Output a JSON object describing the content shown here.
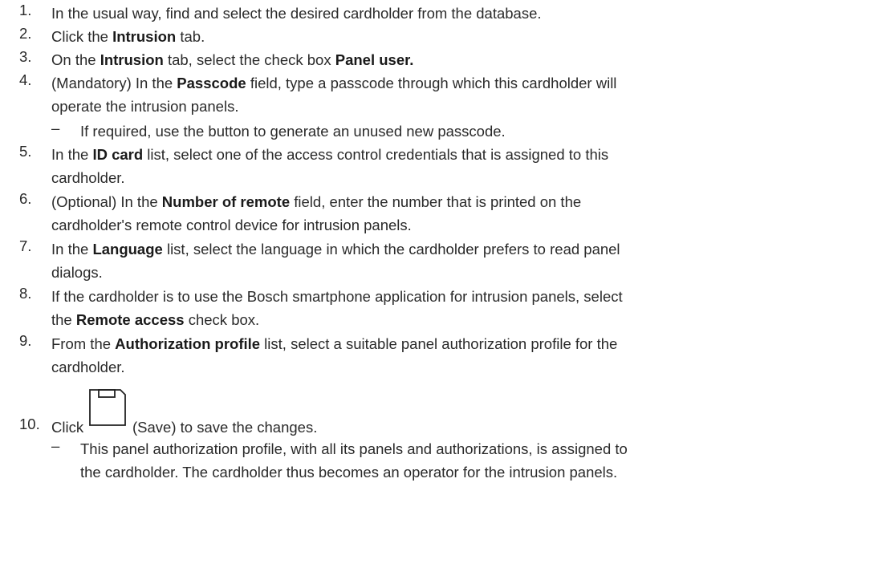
{
  "steps": [
    {
      "num": "1.",
      "parts": [
        {
          "t": "In the usual way, find and select the desired cardholder from the database."
        }
      ]
    },
    {
      "num": "2.",
      "parts": [
        {
          "t": "Click the "
        },
        {
          "b": "Intrusion"
        },
        {
          "t": " tab."
        }
      ]
    },
    {
      "num": "3.",
      "parts": [
        {
          "t": "On the "
        },
        {
          "b": "Intrusion"
        },
        {
          "t": " tab, select the check box "
        },
        {
          "b": "Panel user."
        }
      ]
    },
    {
      "num": "4.",
      "lines": [
        [
          {
            "t": "(Mandatory) In the "
          },
          {
            "b": "Passcode"
          },
          {
            "t": " field, type a passcode through which this cardholder will"
          }
        ],
        [
          {
            "t": "operate the intrusion panels."
          }
        ]
      ]
    },
    {
      "num": "5.",
      "lines": [
        [
          {
            "t": "In the "
          },
          {
            "b": "ID card"
          },
          {
            "t": " list, select one of the access control credentials that is assigned to this"
          }
        ],
        [
          {
            "t": "cardholder."
          }
        ]
      ]
    },
    {
      "num": "6.",
      "lines": [
        [
          {
            "t": "(Optional) In the "
          },
          {
            "b": "Number of remote"
          },
          {
            "t": " field, enter the number that is printed on the"
          }
        ],
        [
          {
            "t": "cardholder's remote control device for intrusion panels."
          }
        ]
      ]
    },
    {
      "num": "7.",
      "lines": [
        [
          {
            "t": "In the "
          },
          {
            "b": "Language"
          },
          {
            "t": " list, select the language in which the cardholder prefers to read panel"
          }
        ],
        [
          {
            "t": "dialogs."
          }
        ]
      ]
    },
    {
      "num": "8.",
      "lines": [
        [
          {
            "t": "If the cardholder is to use the Bosch smartphone application for intrusion panels, select"
          }
        ],
        [
          {
            "t": "the "
          },
          {
            "b": "Remote access"
          },
          {
            "t": " check box."
          }
        ]
      ]
    },
    {
      "num": "9.",
      "lines": [
        [
          {
            "t": "From the "
          },
          {
            "b": "Authorization profile"
          },
          {
            "t": " list, select a suitable panel authorization profile for the"
          }
        ],
        [
          {
            "t": "cardholder."
          }
        ]
      ]
    },
    {
      "num": "10.",
      "before_icon": "Click",
      "after_icon": "(Save) to save the changes.",
      "icon": "save-icon"
    }
  ],
  "sub4": {
    "dash": "–",
    "text": "If required, use the button to generate an unused new passcode."
  },
  "sub10": {
    "dash": "–",
    "lines": [
      "This panel authorization profile, with all its panels and authorizations, is assigned to",
      "the cardholder. The cardholder thus becomes an operator for the intrusion panels."
    ]
  }
}
